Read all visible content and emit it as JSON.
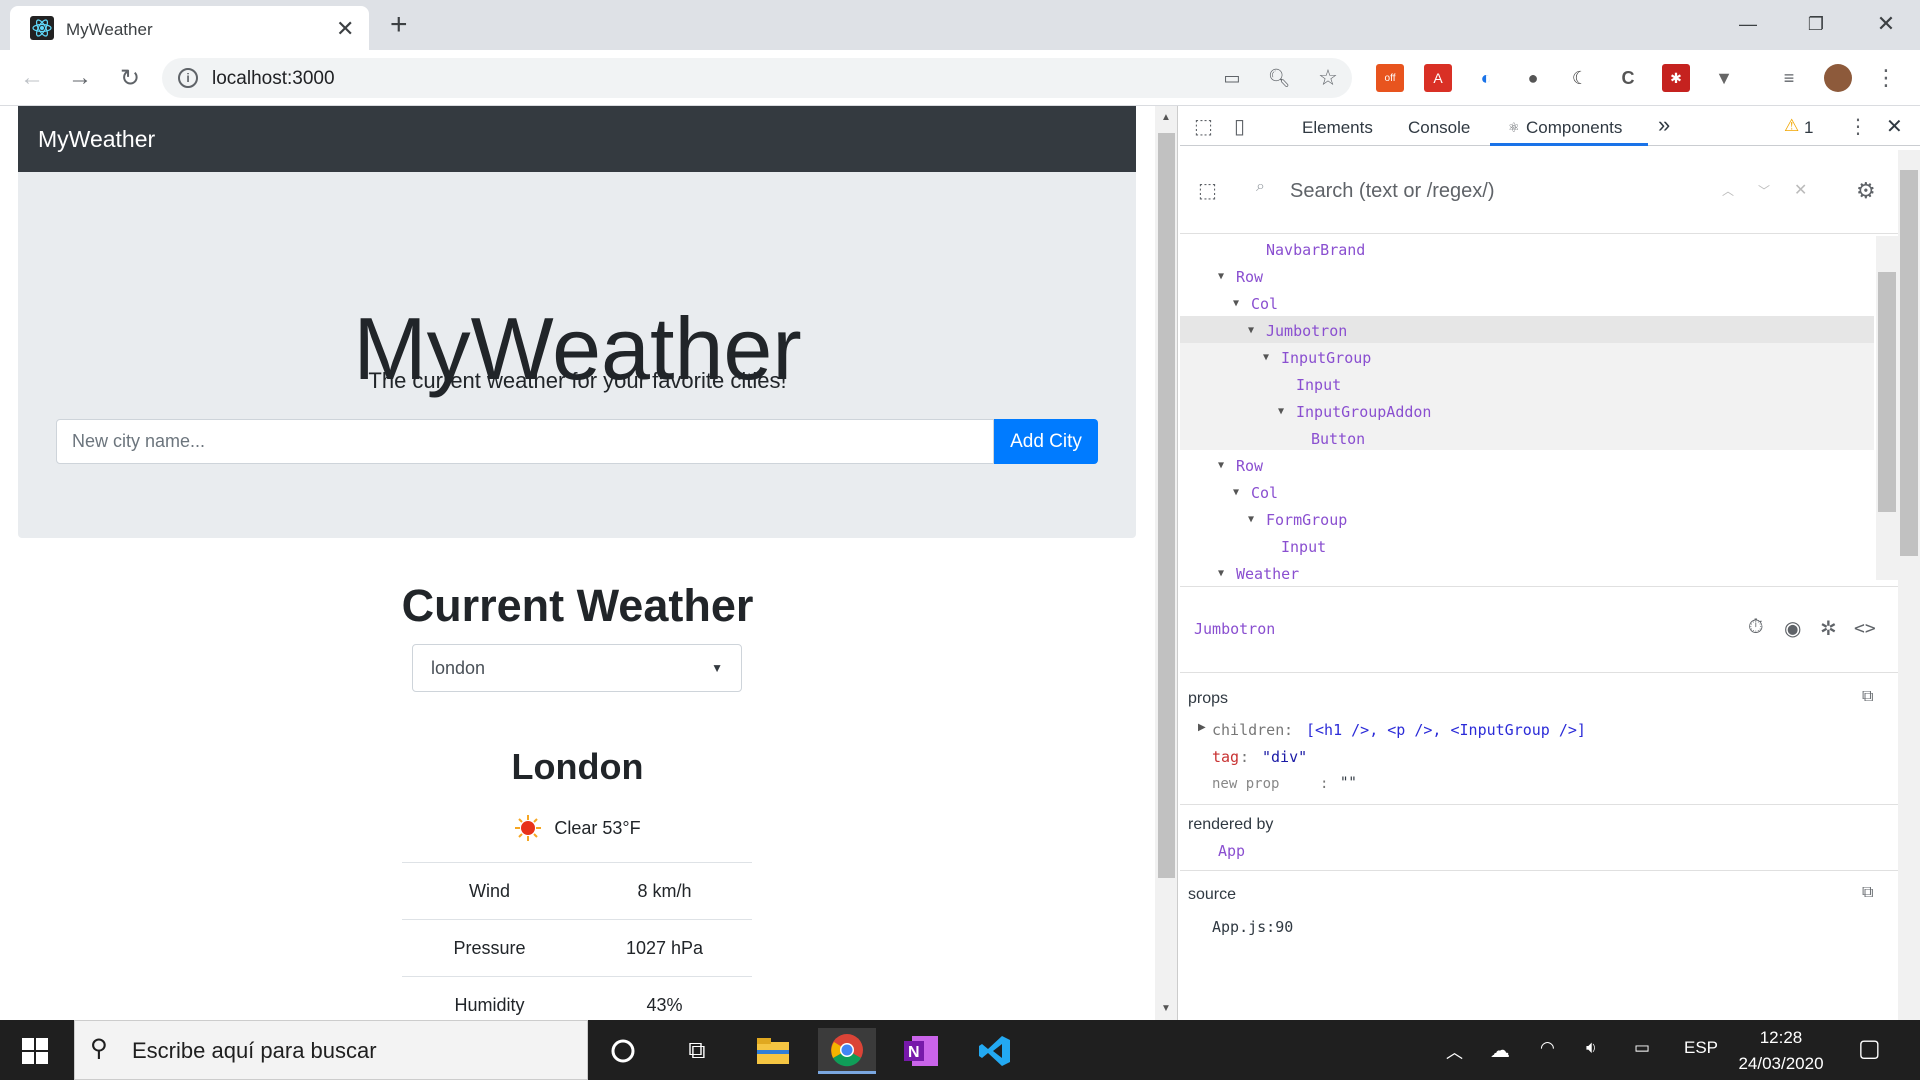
{
  "browser": {
    "tab_title": "MyWeather",
    "url": "localhost:3000"
  },
  "app": {
    "navbar_brand": "MyWeather",
    "jumbotron": {
      "title": "MyWeather",
      "subtitle": "The current weather for your favorite cities!",
      "input_placeholder": "New city name...",
      "add_button": "Add City"
    },
    "current_weather_title": "Current Weather",
    "city_select_value": "london",
    "city_name": "London",
    "condition": "Clear 53°F",
    "table": [
      {
        "label": "Wind",
        "value": "8 km/h"
      },
      {
        "label": "Pressure",
        "value": "1027 hPa"
      },
      {
        "label": "Humidity",
        "value": "43%"
      }
    ]
  },
  "devtools": {
    "tabs": [
      "Elements",
      "Console",
      "Components"
    ],
    "active_tab": "Components",
    "more_tabs": "»",
    "warning_count": "1",
    "search_placeholder": "Search (text or /regex/)",
    "tree": [
      {
        "label": "NavbarBrand",
        "expanded": false
      },
      {
        "label": "Row",
        "expanded": true
      },
      {
        "label": "Col",
        "expanded": true
      },
      {
        "label": "Jumbotron",
        "expanded": true,
        "selected": true
      },
      {
        "label": "InputGroup",
        "expanded": true
      },
      {
        "label": "Input",
        "expanded": false
      },
      {
        "label": "InputGroupAddon",
        "expanded": true
      },
      {
        "label": "Button",
        "expanded": false
      },
      {
        "label": "Row",
        "expanded": true
      },
      {
        "label": "Col",
        "expanded": true
      },
      {
        "label": "FormGroup",
        "expanded": true
      },
      {
        "label": "Input",
        "expanded": false
      },
      {
        "label": "Weather",
        "expanded": true
      }
    ],
    "selected_component": "Jumbotron",
    "props_title": "props",
    "props": {
      "children_key": "children",
      "children_value": "[<h1 />, <p />, <InputGroup />]",
      "tag_key": "tag",
      "tag_value": "\"div\"",
      "new_prop_key": "new prop",
      "new_prop_value": "\"\""
    },
    "rendered_by_title": "rendered by",
    "rendered_by": "App",
    "source_title": "source",
    "source": "App.js:90"
  },
  "taskbar": {
    "search_placeholder": "Escribe aquí para buscar",
    "language": "ESP",
    "time": "12:28",
    "date": "24/03/2020"
  }
}
